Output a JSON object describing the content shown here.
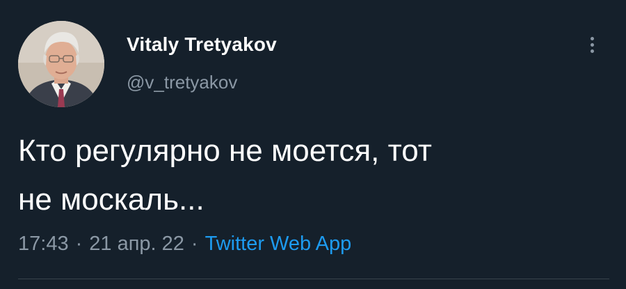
{
  "author": {
    "display_name": "Vitaly Tretyakov",
    "handle": "@v_tretyakov",
    "avatar_icon": "profile-photo"
  },
  "tweet": {
    "text_line1": "Кто регулярно не моется, тот",
    "text_line2": "не москаль..."
  },
  "meta": {
    "time": "17:43",
    "separator": "·",
    "date": "21 апр. 22",
    "source": "Twitter Web App"
  },
  "icons": {
    "more": "more-vertical-icon"
  },
  "colors": {
    "background": "#15202b",
    "text_primary": "#ffffff",
    "text_secondary": "#8b98a5",
    "link": "#1d9bf0",
    "divider": "#38444d"
  }
}
